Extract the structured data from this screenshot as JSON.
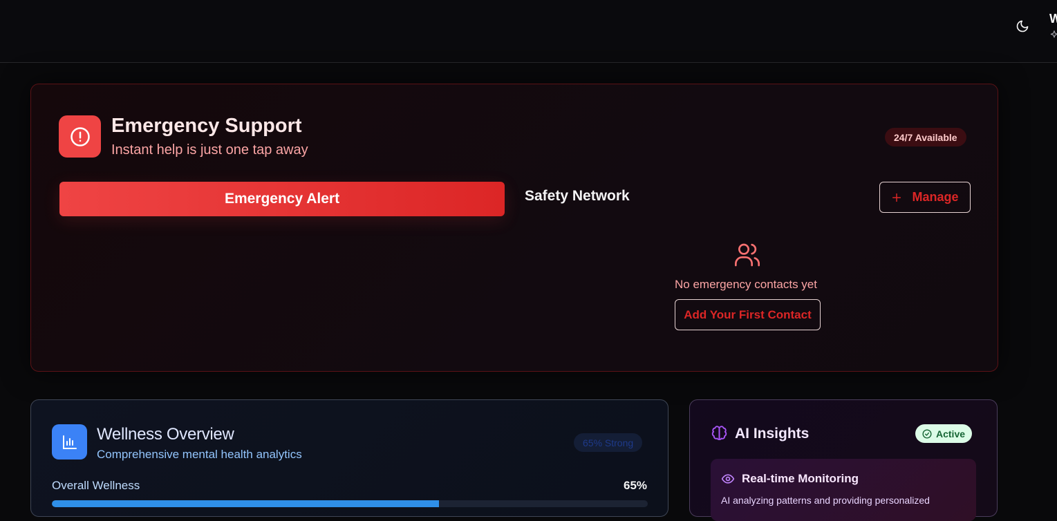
{
  "header": {
    "user_initial": "W",
    "icons": [
      "moon-icon",
      "sparkle-icon"
    ]
  },
  "emergency": {
    "title": "Emergency Support",
    "subtitle": "Instant help is just one tap away",
    "badge": "24/7 Available",
    "alert_button": "Emergency Alert",
    "network_title": "Safety Network",
    "manage_button": "Manage",
    "empty_text": "No emergency contacts yet",
    "add_contact_button": "Add Your First Contact",
    "icons": [
      "alert-circle-icon",
      "plus-icon",
      "users-icon"
    ],
    "accent_color": "#ef4444"
  },
  "wellness": {
    "title": "Wellness Overview",
    "subtitle": "Comprehensive mental health analytics",
    "badge": "65% Strong",
    "overall_label": "Overall Wellness",
    "overall_value": "65%",
    "overall_progress": 0.65,
    "icons": [
      "bar-chart-icon"
    ],
    "accent_color": "#3b82f6"
  },
  "ai_insights": {
    "title": "AI Insights",
    "badge": "Active",
    "monitoring_title": "Real-time Monitoring",
    "monitoring_desc": "AI analyzing patterns and providing personalized",
    "icons": [
      "brain-icon",
      "check-circle-icon",
      "eye-icon"
    ],
    "accent_color": "#a855f7"
  }
}
